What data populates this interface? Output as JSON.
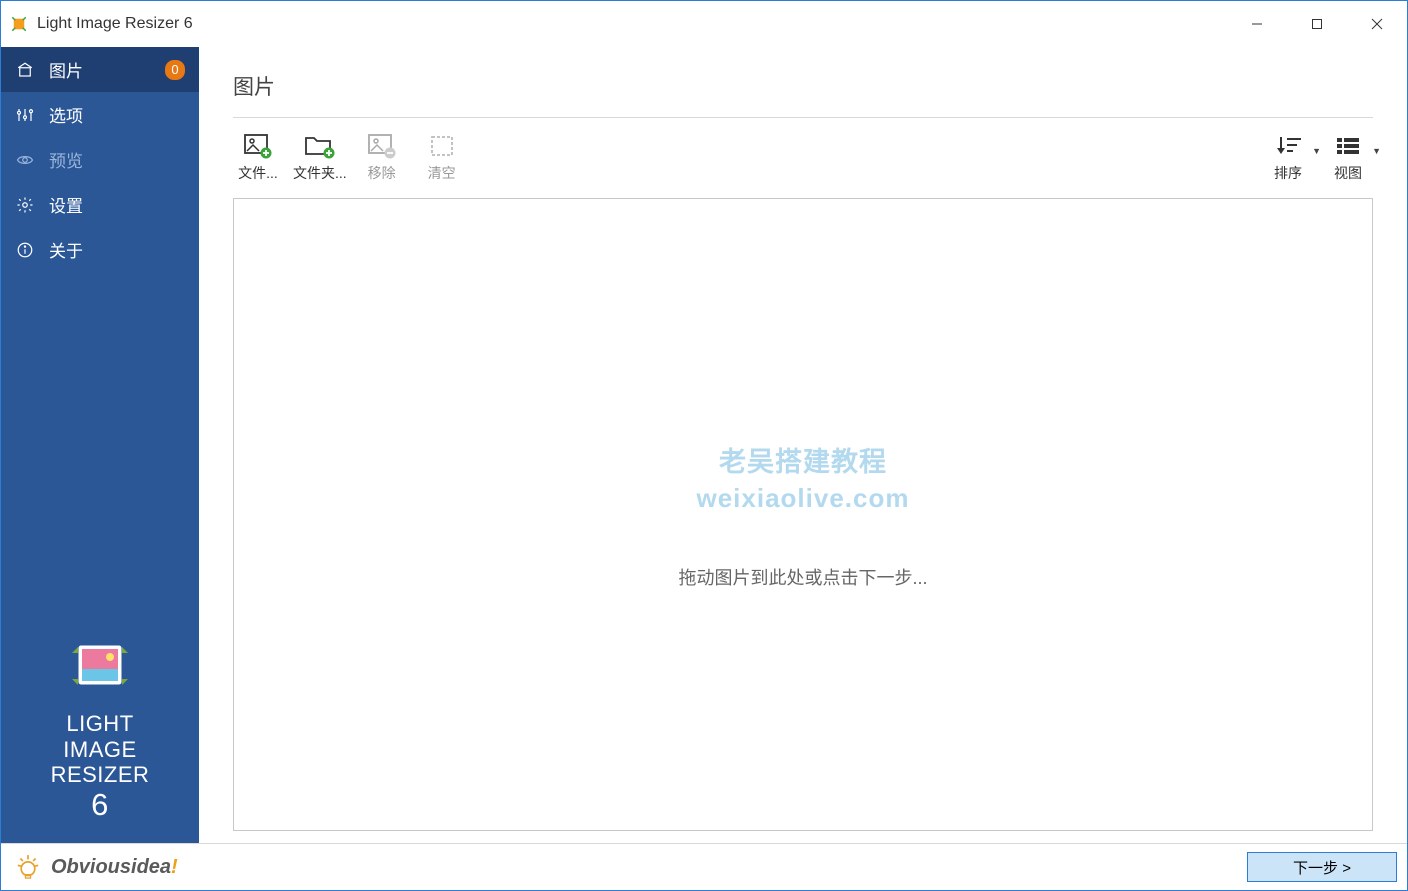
{
  "window": {
    "title": "Light Image Resizer 6"
  },
  "sidebar": {
    "items": [
      {
        "label": "图片",
        "badge": "0",
        "active": true
      },
      {
        "label": "选项"
      },
      {
        "label": "预览",
        "dim": true
      },
      {
        "label": "设置"
      },
      {
        "label": "关于"
      }
    ],
    "logo": {
      "line1": "LIGHT",
      "line2": "IMAGE",
      "line3": "RESIZER",
      "line4": "6"
    }
  },
  "main": {
    "title": "图片",
    "toolbar": {
      "left": [
        {
          "label": "文件...",
          "name": "add-files-button"
        },
        {
          "label": "文件夹...",
          "name": "add-folder-button"
        },
        {
          "label": "移除",
          "name": "remove-button",
          "disabled": true
        },
        {
          "label": "清空",
          "name": "clear-button",
          "disabled": true
        }
      ],
      "right": [
        {
          "label": "排序",
          "name": "sort-button"
        },
        {
          "label": "视图",
          "name": "view-button"
        }
      ]
    },
    "dropzone": {
      "watermark_cn": "老吴搭建教程",
      "watermark_en": "weixiaolive.com",
      "hint": "拖动图片到此处或点击下一步..."
    }
  },
  "footer": {
    "brand": "Obviousidea",
    "brand_exclaim": "!",
    "next": "下一步  >"
  }
}
